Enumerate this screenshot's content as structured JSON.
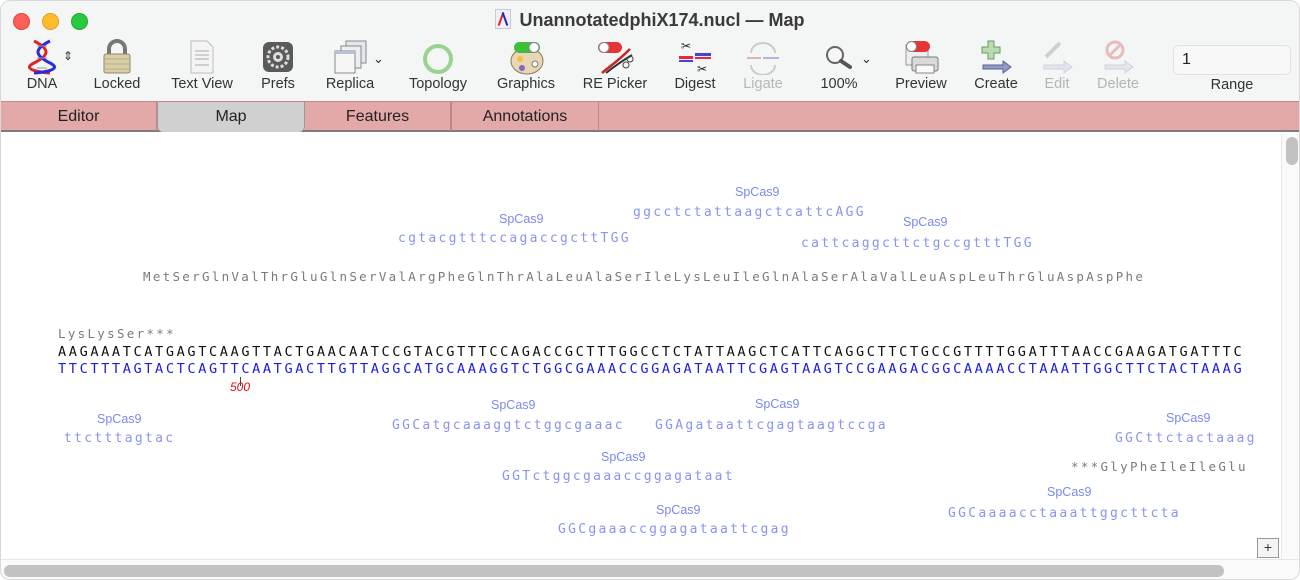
{
  "window": {
    "title": "UnannotatedphiX174.nucl — Map"
  },
  "toolbar": {
    "items": [
      {
        "label": "DNA",
        "icon": "dna-helix-icon",
        "enabled": true
      },
      {
        "label": "Locked",
        "icon": "padlock-icon",
        "enabled": true
      },
      {
        "label": "Text View",
        "icon": "text-document-icon",
        "enabled": true
      },
      {
        "label": "Prefs",
        "icon": "gear-icon",
        "enabled": true
      },
      {
        "label": "Replica",
        "icon": "stacked-windows-icon",
        "enabled": true
      },
      {
        "label": "Topology",
        "icon": "circle-ring-icon",
        "enabled": true
      },
      {
        "label": "Graphics",
        "icon": "palette-icon",
        "enabled": true
      },
      {
        "label": "RE Picker",
        "icon": "scissors-dna-icon",
        "enabled": true
      },
      {
        "label": "Digest",
        "icon": "digest-icon",
        "enabled": true
      },
      {
        "label": "Ligate",
        "icon": "ligate-icon",
        "enabled": false
      },
      {
        "label": "100%",
        "icon": "magnifier-icon",
        "enabled": true
      },
      {
        "label": "Preview",
        "icon": "printer-icon",
        "enabled": true
      },
      {
        "label": "Create",
        "icon": "plus-arrow-icon",
        "enabled": true
      },
      {
        "label": "Edit",
        "icon": "pencil-arrow-icon",
        "enabled": false
      },
      {
        "label": "Delete",
        "icon": "prohibit-arrow-icon",
        "enabled": false
      }
    ],
    "range": {
      "value": "1",
      "label": "Range"
    }
  },
  "tabs": [
    {
      "label": "Editor",
      "active": false
    },
    {
      "label": "Map",
      "active": true
    },
    {
      "label": "Features",
      "active": false
    },
    {
      "label": "Annotations",
      "active": false
    }
  ],
  "map": {
    "top_strand": "AAGAAATCATGAGTCAAGTTACTGAACAATCCGTACGTTTCCAGACCGCTTTGGCCTCTATTAAGCTCATTCAGGCTTCTGCCGTTTTGGATTTAACCGAAGATGATTTC",
    "bottom_strand": "TTCTTTAGTACTCAGTTCAATGACTTGTTAGGCATGCAAAGGTCTGGCGAAACCGGAGATAATTCGAGTAAGTCCGAAGACGGCAAAACCTAAATTGGCTTCTACTAAAG",
    "translation_forward": "MetSerGlnValThrGluGlnSerValArgPheGlnThrAlaLeuAlaSerIleLysLeuIleGlnAlaSerAlaValLeuAspLeuThrGluAspAspPhe",
    "translation_left": "LysLysSer***",
    "translation_reverse": "***GlyPheIleIleGlu",
    "position_marker": "500",
    "guides_top": [
      {
        "label": "SpCas9",
        "sequence": "cgtacgtttccagaccgcttTGG"
      },
      {
        "label": "SpCas9",
        "sequence": "ggcctctattaagctcattcAGG"
      },
      {
        "label": "SpCas9",
        "sequence": "cattcaggcttctgccgtttTGG"
      }
    ],
    "guides_bottom": [
      {
        "label": "SpCas9",
        "sequence": "ttctttagtac"
      },
      {
        "label": "SpCas9",
        "sequence": "GGCatgcaaaggtctggcgaaac"
      },
      {
        "label": "SpCas9",
        "sequence": "GGAgataattcgagtaagtccga"
      },
      {
        "label": "SpCas9",
        "sequence": "GGCttctactaaag"
      },
      {
        "label": "SpCas9",
        "sequence": "GGTctggcgaaaccggagataat"
      },
      {
        "label": "SpCas9",
        "sequence": "GGCaaaacctaaattggcttcta"
      },
      {
        "label": "SpCas9",
        "sequence": "GGCgaaaccggagataattcgag"
      }
    ]
  },
  "statusbar": {
    "zoom_button": "+"
  }
}
